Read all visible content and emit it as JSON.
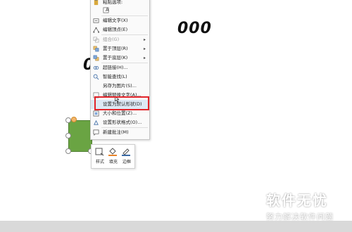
{
  "slide": {
    "text_top": "000",
    "text_left": "0"
  },
  "context_menu": {
    "items": [
      {
        "label": "粘贴选项:",
        "disabled": false
      },
      {
        "label": "A",
        "disabled": false
      },
      {
        "label": "编辑文字(X)",
        "disabled": false
      },
      {
        "label": "编辑顶点(E)",
        "disabled": false
      },
      {
        "label": "组合(G)",
        "disabled": true,
        "submenu": "▸"
      },
      {
        "label": "置于顶层(R)",
        "disabled": false,
        "submenu": "▸"
      },
      {
        "label": "置于底层(K)",
        "disabled": false,
        "submenu": "▸"
      },
      {
        "label": "超链接(H)...",
        "disabled": false
      },
      {
        "label": "智能查找(L)",
        "disabled": false
      },
      {
        "label": "另存为图片(S)...",
        "disabled": false
      },
      {
        "label": "编辑替换文字(A)...",
        "disabled": false
      },
      {
        "label": "设置为默认形状(D)",
        "disabled": false,
        "highlighted": true
      },
      {
        "label": "大小和位置(Z)...",
        "disabled": false
      },
      {
        "label": "设置形状格式(O)...",
        "disabled": false
      },
      {
        "label": "新建批注(M)",
        "disabled": false
      }
    ]
  },
  "mini_toolbar": {
    "style_label": "样式",
    "fill_label": "填充",
    "border_label": "边框"
  },
  "watermark": {
    "title": "软件无忧",
    "subtitle": "努力解决软件问题"
  },
  "colors": {
    "shape_fill": "#6aa443",
    "highlight_ring": "#e2242a"
  }
}
